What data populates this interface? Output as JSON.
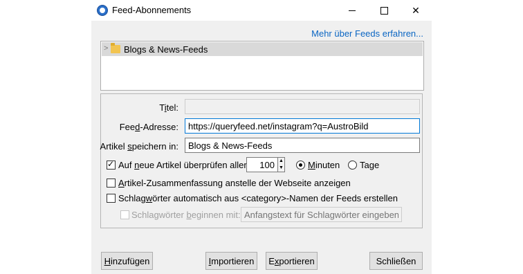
{
  "window": {
    "title": "Feed-Abonnements",
    "minimize_icon": "minimize-icon",
    "maximize_icon": "maximize-icon",
    "close_icon": "close-icon",
    "close_glyph": "✕"
  },
  "header": {
    "learn_more_link": "Mehr über Feeds erfahren..."
  },
  "tree": {
    "items": [
      {
        "label": "Blogs & News-Feeds",
        "icon": "folder-icon",
        "twisty": ">"
      }
    ]
  },
  "form": {
    "title_label_a": "T",
    "title_label_u": "i",
    "title_label_b": "tel:",
    "title_value": "",
    "address_label_a": "Fee",
    "address_label_u": "d",
    "address_label_b": "-Adresse:",
    "address_value": "https://queryfeed.net/instagram?q=AustroBild",
    "store_label_a": "Artikel ",
    "store_label_u": "s",
    "store_label_b": "peichern in:",
    "store_value": "Blogs & News-Feeds",
    "check_label_a": "Auf ",
    "check_label_u": "n",
    "check_label_b": "eue Artikel überprüfen aller",
    "check_checked": true,
    "interval_value": "100",
    "minutes_label_u": "M",
    "minutes_label_b": "inuten",
    "days_label": "Tage",
    "summary_label_u": "A",
    "summary_label_b": "rtikel-Zusammenfassung anstelle der Webseite anzeigen",
    "tags_label_a": "Schlag",
    "tags_label_u": "w",
    "tags_label_b": "örter automatisch aus <category>-Namen der Feeds erstellen",
    "prefix_label_a": "Schlagwörter ",
    "prefix_label_u": "b",
    "prefix_label_b": "eginnen mit:",
    "prefix_placeholder": "Anfangstext für Schlagwörter eingeben"
  },
  "buttons": {
    "add_u": "H",
    "add_b": "inzufügen",
    "import_u": "I",
    "import_b": "mportieren",
    "export_u": "x",
    "export_a": "E",
    "export_b": "portieren",
    "close": "Schließen"
  },
  "colors": {
    "link": "#0b66c3",
    "focus_border": "#0078d7",
    "selection": "#d9d9d9"
  }
}
